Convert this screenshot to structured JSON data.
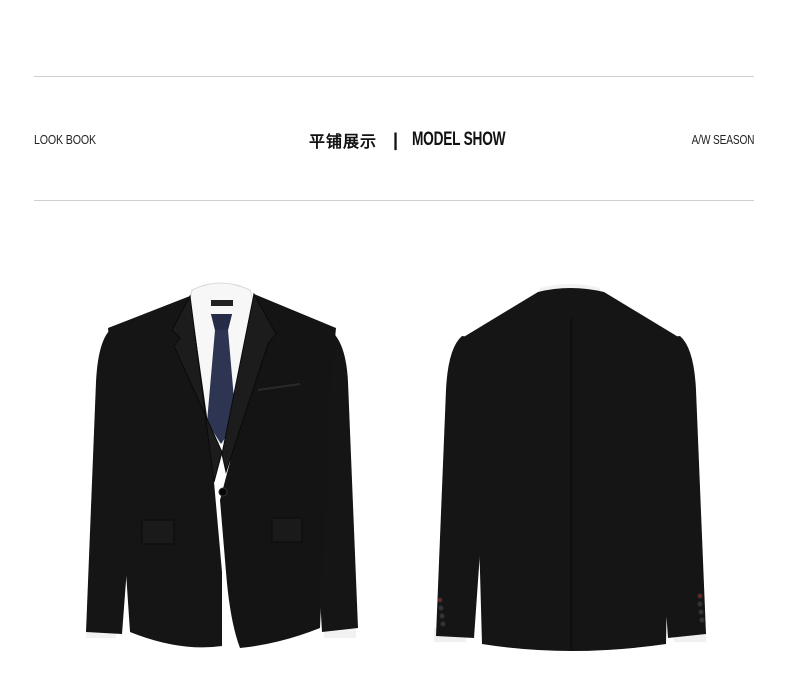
{
  "header": {
    "left_label": "LOOK BOOK",
    "title_cn": "平铺展示",
    "divider": "|",
    "title_en": "MODEL SHOW",
    "right_label": "A/W SEASON"
  },
  "colors": {
    "jacket": "#151515",
    "shirt": "#f7f7f7",
    "tie": "#2e3553",
    "rule": "#cfcfcf"
  },
  "images": {
    "front_view": "suit-jacket-front-image",
    "back_view": "suit-jacket-back-image"
  }
}
